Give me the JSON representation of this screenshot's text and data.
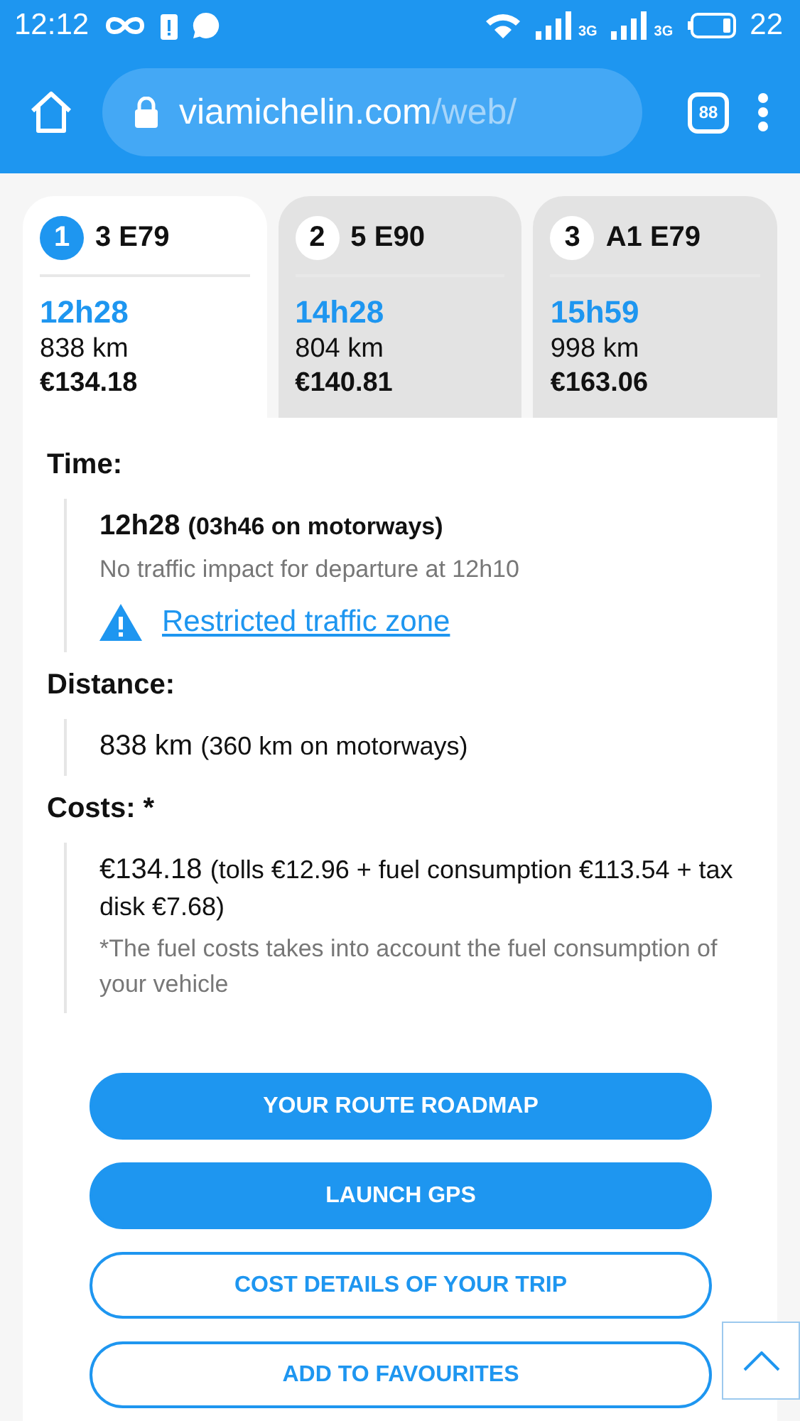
{
  "status_bar": {
    "time": "12:12",
    "network_1": "3G",
    "network_2": "3G",
    "battery": "22"
  },
  "browser": {
    "url_host": "viamichelin.com",
    "url_path": "/web/",
    "tab_count": "88"
  },
  "routes": [
    {
      "number": "1",
      "name": "3 E79",
      "time": "12h28",
      "distance": "838 km",
      "cost": "€134.18",
      "selected": true
    },
    {
      "number": "2",
      "name": "5 E90",
      "time": "14h28",
      "distance": "804 km",
      "cost": "€140.81",
      "selected": false
    },
    {
      "number": "3",
      "name": "A1 E79",
      "time": "15h59",
      "distance": "998 km",
      "cost": "€163.06",
      "selected": false
    }
  ],
  "details": [
    {
      "heading": "Time:",
      "value": "12h28",
      "note": "(03h46 on motorways)",
      "kind": "time",
      "sub": "No traffic impact for departure at 12h10",
      "link": "Restricted traffic zone"
    },
    {
      "heading": "Distance:",
      "value": "838 km",
      "note": "(360 km on motorways)",
      "kind": "distance"
    },
    {
      "heading": "Costs: *",
      "value": "€134.18",
      "note": "(tolls €12.96 + fuel consumption €113.54 + tax disk €7.68)",
      "kind": "costs",
      "sub": "*The fuel costs takes into account the fuel consumption of your vehicle"
    }
  ],
  "buttons": [
    {
      "label": "YOUR ROUTE ROADMAP",
      "kind": "filled"
    },
    {
      "label": "LAUNCH GPS",
      "kind": "filled"
    },
    {
      "label": "COST DETAILS OF YOUR TRIP",
      "kind": "outline"
    },
    {
      "label": "ADD TO FAVOURITES",
      "kind": "outline"
    }
  ]
}
